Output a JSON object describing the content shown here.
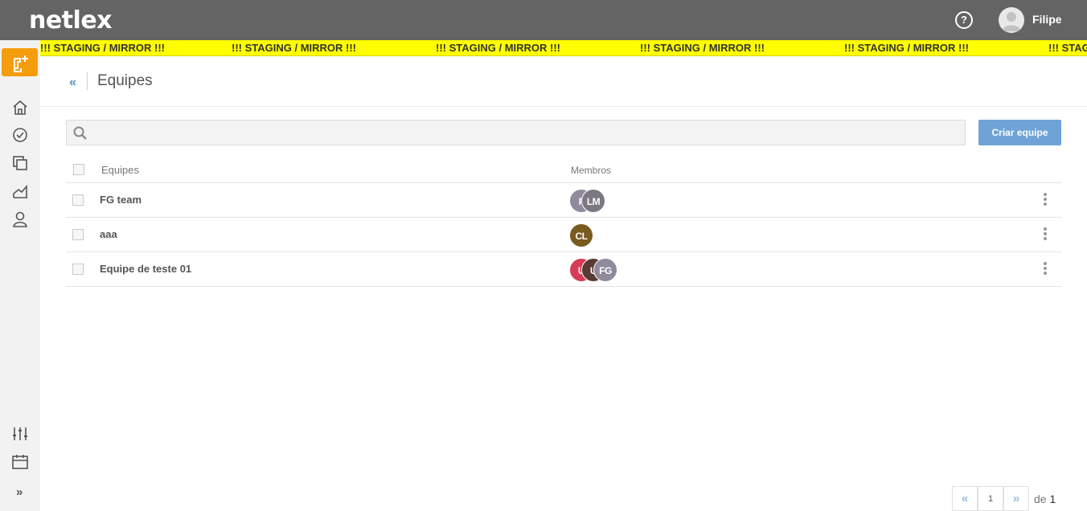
{
  "app": {
    "logo": "netlex",
    "user_name": "Filipe"
  },
  "banner": {
    "text": "!!! STAGING / MIRROR !!!"
  },
  "header": {
    "back_glyph": "«",
    "title": "Equipes"
  },
  "search": {
    "placeholder": "",
    "value": ""
  },
  "actions": {
    "create_label": "Criar equipe"
  },
  "table": {
    "columns": [
      "Equipes",
      "Membros"
    ],
    "rows": [
      {
        "name": "FG team",
        "members": [
          {
            "initials": "F",
            "color": "#8f8a9c"
          },
          {
            "initials": "LM",
            "color": "#7b7882"
          }
        ]
      },
      {
        "name": "aaa",
        "members": [
          {
            "initials": "CL",
            "color": "#7a5a1e"
          }
        ]
      },
      {
        "name": "Equipe de teste 01",
        "members": [
          {
            "initials": "U",
            "color": "#d63c56"
          },
          {
            "initials": "U",
            "color": "#5a3a35"
          },
          {
            "initials": "FG",
            "color": "#8f8a9c"
          }
        ]
      }
    ]
  },
  "pagination": {
    "current_page": "1",
    "of_label": "de",
    "total_pages": "1",
    "first_glyph": "«",
    "last_glyph": "»"
  },
  "sidebar": {
    "items": [
      "add-task-icon",
      "home-icon",
      "tasks-icon",
      "documents-icon",
      "reports-icon",
      "contacts-icon",
      "settings-sliders-icon",
      "calendar-icon",
      "expand-icon"
    ],
    "expand_glyph": "»"
  },
  "colors": {
    "accent": "#f59d0c",
    "primary": "#6fa3d6",
    "banner": "#ffff00",
    "topbar": "#646464"
  }
}
